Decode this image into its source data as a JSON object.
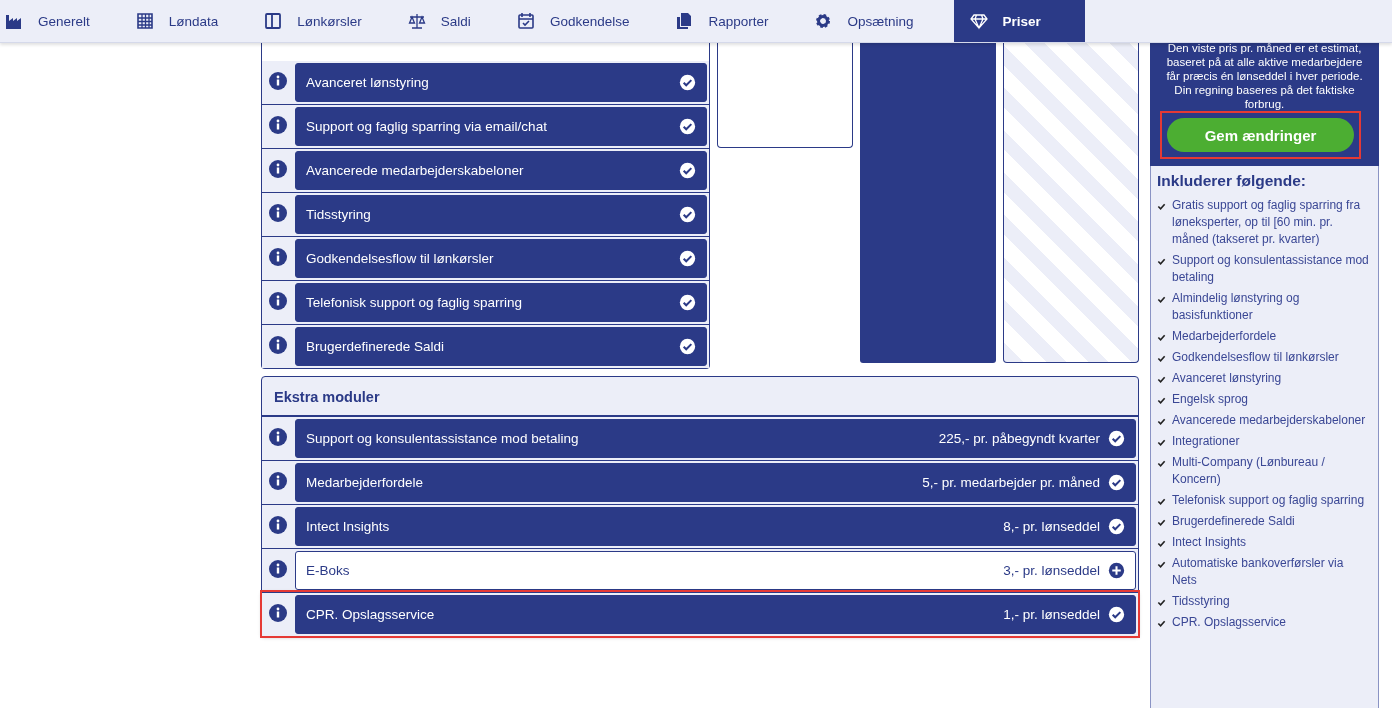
{
  "nav": {
    "tabs": [
      {
        "label": "Generelt",
        "selected": false
      },
      {
        "label": "Løndata",
        "selected": false
      },
      {
        "label": "Lønkørsler",
        "selected": false
      },
      {
        "label": "Saldi",
        "selected": false
      },
      {
        "label": "Godkendelse",
        "selected": false
      },
      {
        "label": "Rapporter",
        "selected": false
      },
      {
        "label": "Opsætning",
        "selected": false
      },
      {
        "label": "Priser",
        "selected": true
      }
    ]
  },
  "included_modules": [
    {
      "label": "Avanceret lønstyring",
      "selected": true
    },
    {
      "label": "Support og faglig sparring via email/chat",
      "selected": true
    },
    {
      "label": "Avancerede medarbejderskabeloner",
      "selected": true
    },
    {
      "label": "Tidsstyring",
      "selected": true
    },
    {
      "label": "Godkendelsesflow til lønkørsler",
      "selected": true
    },
    {
      "label": "Telefonisk support og faglig sparring",
      "selected": true
    },
    {
      "label": "Brugerdefinerede Saldi",
      "selected": true
    }
  ],
  "extra_modules": {
    "title": "Ekstra moduler",
    "items": [
      {
        "label": "Support og konsulentassistance mod betaling",
        "price": "225,- pr. påbegyndt kvarter",
        "selected": true,
        "highlighted": false
      },
      {
        "label": "Medarbejderfordele",
        "price": "5,- pr. medarbejder pr. måned",
        "selected": true,
        "highlighted": false
      },
      {
        "label": "Intect Insights",
        "price": "8,- pr. lønseddel",
        "selected": true,
        "highlighted": false
      },
      {
        "label": "E-Boks",
        "price": "3,- pr. lønseddel",
        "selected": false,
        "highlighted": false
      },
      {
        "label": "CPR. Opslagsservice",
        "price": "1,- pr. lønseddel",
        "selected": true,
        "highlighted": true
      }
    ]
  },
  "summary": {
    "note": "Den viste pris pr. måned er et estimat, baseret på at alle aktive medarbejdere får præcis én lønseddel i hver periode. Din regning baseres på det faktiske forbrug.",
    "save_button": {
      "label": "Gem ændringer",
      "highlighted": true
    },
    "includes_title": "Inkluderer følgende:",
    "includes": [
      "Gratis support og faglig sparring fra løneksperter, op til [60 min. pr. måned (takseret pr. kvarter)",
      "Support og konsulentassistance mod betaling",
      "Almindelig lønstyring og basisfunktioner",
      "Medarbejderfordele",
      "Godkendelsesflow til lønkørsler",
      "Avanceret lønstyring",
      "Engelsk sprog",
      "Avancerede medarbejderskabeloner",
      "Integrationer",
      "Multi-Company (Lønbureau / Koncern)",
      "Telefonisk support og faglig sparring",
      "Brugerdefinerede Saldi",
      "Intect Insights",
      "Automatiske bankoverførsler via Nets",
      "Tidsstyring",
      "CPR. Opslagsservice"
    ]
  }
}
